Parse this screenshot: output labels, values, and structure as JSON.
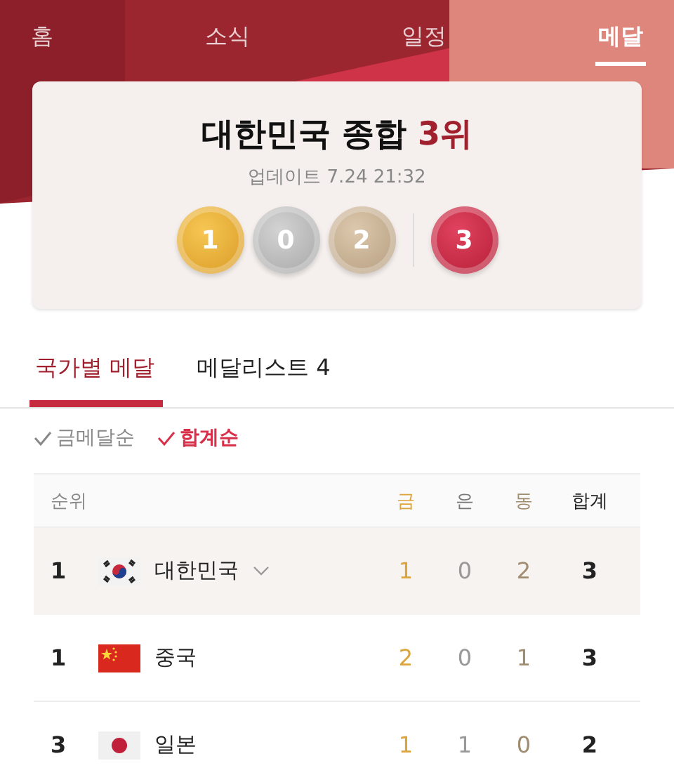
{
  "nav_tabs": [
    {
      "label": "홈",
      "selected": false
    },
    {
      "label": "소식",
      "selected": false
    },
    {
      "label": "일정",
      "selected": false
    },
    {
      "label": "메달",
      "selected": true
    }
  ],
  "summary": {
    "title": "대한민국 종합",
    "rank": "3위",
    "updated": "업데이트 7.24 21:32",
    "medals": [
      {
        "kind": "gold",
        "count": "1"
      },
      {
        "kind": "silver",
        "count": "0"
      },
      {
        "kind": "bronze",
        "count": "2"
      },
      {
        "kind": "total",
        "count": "3"
      }
    ]
  },
  "sub_tabs": [
    {
      "label": "국가별 메달",
      "selected": true
    },
    {
      "label": "메달리스트 4",
      "selected": false
    }
  ],
  "sort_options": [
    {
      "label": "금메달순",
      "selected": false
    },
    {
      "label": "합계순",
      "selected": true
    }
  ],
  "table": {
    "columns": [
      {
        "label": "순위",
        "kind": "rank"
      },
      {
        "label": "금",
        "kind": "gold"
      },
      {
        "label": "은",
        "kind": "silver"
      },
      {
        "label": "동",
        "kind": "bronze"
      },
      {
        "label": "합계",
        "kind": "total"
      }
    ],
    "rows": [
      {
        "rank": "1",
        "kind": "kr",
        "country": "대한민국",
        "expandable": true,
        "highlighted": true,
        "gold": "1",
        "silver": "0",
        "bronze": "2",
        "total": "3"
      },
      {
        "rank": "1",
        "kind": "cn",
        "country": "중국",
        "expandable": false,
        "highlighted": false,
        "gold": "2",
        "silver": "0",
        "bronze": "1",
        "total": "3"
      },
      {
        "rank": "3",
        "kind": "jp",
        "country": "일본",
        "expandable": false,
        "highlighted": false,
        "gold": "1",
        "silver": "1",
        "bronze": "0",
        "total": "2"
      }
    ]
  }
}
